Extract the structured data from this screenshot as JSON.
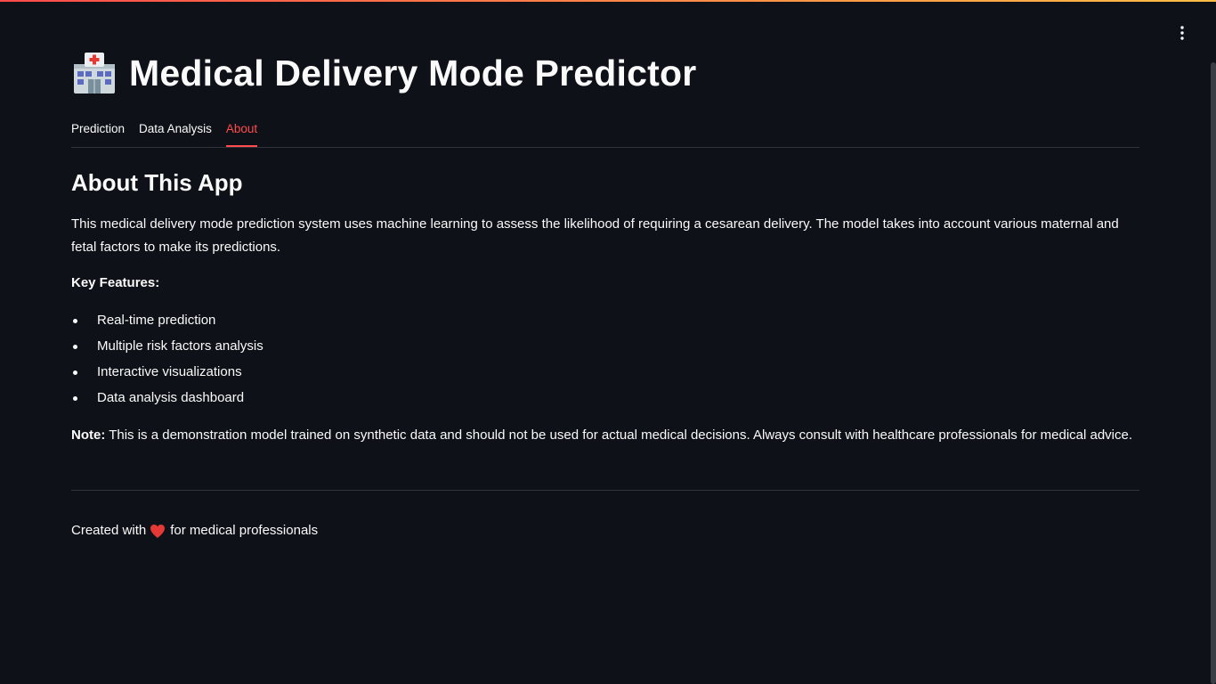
{
  "app": {
    "title": "Medical Delivery Mode Predictor",
    "title_icon": "hospital-icon",
    "menu_icon": "vertical-dots-icon"
  },
  "tabs": [
    {
      "label": "Prediction",
      "active": false
    },
    {
      "label": "Data Analysis",
      "active": false
    },
    {
      "label": "About",
      "active": true
    }
  ],
  "about": {
    "heading": "About This App",
    "description": "This medical delivery mode prediction system uses machine learning to assess the likelihood of requiring a cesarean delivery. The model takes into account various maternal and fetal factors to make its predictions.",
    "features_label": "Key Features:",
    "features": [
      "Real-time prediction",
      "Multiple risk factors analysis",
      "Interactive visualizations",
      "Data analysis dashboard"
    ],
    "note_label": "Note:",
    "note_text": " This is a demonstration model trained on synthetic data and should not be used for actual medical decisions. Always consult with healthcare professionals for medical advice."
  },
  "footer": {
    "prefix": "Created with",
    "icon": "heart-icon",
    "suffix": "for medical professionals"
  },
  "colors": {
    "background": "#0e1117",
    "text": "#fafafa",
    "accent": "#ff4b4b",
    "divider": "#31333f"
  }
}
